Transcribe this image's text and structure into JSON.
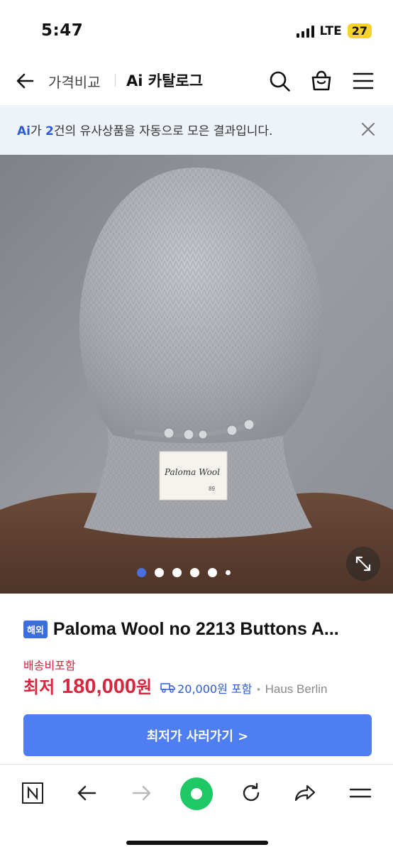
{
  "status_bar": {
    "time": "5:47",
    "network": "LTE",
    "battery": "27"
  },
  "nav": {
    "breadcrumb": "가격비교",
    "title": "Ai 카탈로그",
    "icons": [
      "back-arrow-icon",
      "search-icon",
      "shopping-bag-icon",
      "menu-icon"
    ]
  },
  "ai_banner": {
    "mark": "Ai",
    "text_before": "가 ",
    "count": "2",
    "text_after": "건의 유사상품을 자동으로 모은 결과입니다."
  },
  "gallery": {
    "dot_count": 6,
    "active_index": 0,
    "label_brand": "Paloma Wool",
    "label_number": "89"
  },
  "product": {
    "badge": "해외",
    "title": "Paloma Wool no 2213 Buttons A...",
    "shipping_note": "배송비포함",
    "price_label": "최저",
    "price_value": "180,000",
    "price_unit": "원",
    "shipping_fee": "20,000원 포함",
    "mall_separator": "•",
    "mall_name": "Haus Berlin",
    "cta_label": "최저가 사러가기 >"
  },
  "colors": {
    "accent_blue": "#4e7ef1",
    "price_red": "#d7263d",
    "home_green": "#1ec864",
    "banner_bg": "#eef3fa"
  }
}
